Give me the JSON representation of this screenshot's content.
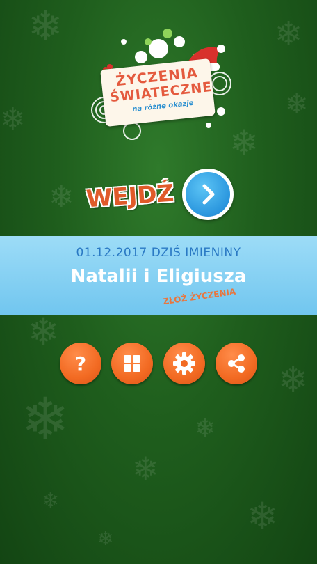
{
  "logo": {
    "title_line1": "ŻYCZENIA",
    "title_line2": "ŚWIĄTECZNE",
    "subtitle": "na różne okazje"
  },
  "enter": {
    "label": "WEJDŹ",
    "icon": "chevron-right-icon"
  },
  "nameday": {
    "date_line": "01.12.2017 DZIŚ IMIENINY",
    "names": "Natalii i Eligiusza",
    "wish_link": "ZŁÓŻ ŻYCZENIA"
  },
  "buttons": [
    {
      "icon": "help-icon"
    },
    {
      "icon": "grid-icon"
    },
    {
      "icon": "gear-icon"
    },
    {
      "icon": "share-icon"
    }
  ],
  "colors": {
    "background": "#1f5e1d",
    "band": "#86d0f3",
    "accent_orange": "#f26a22",
    "accent_blue": "#2a96de"
  }
}
